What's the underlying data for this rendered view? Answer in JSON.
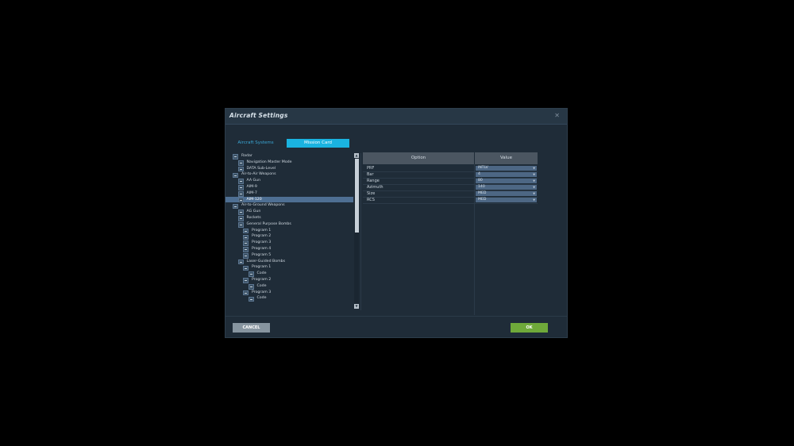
{
  "window": {
    "title": "Aircraft Settings",
    "close_glyph": "✕"
  },
  "tabs": [
    {
      "label": "Aircraft Systems",
      "active": false
    },
    {
      "label": "Mission Card",
      "active": true
    }
  ],
  "tree": [
    {
      "label": "Radar",
      "depth": 0,
      "selected": false
    },
    {
      "label": "Navigation Master Mode",
      "depth": 1,
      "selected": false
    },
    {
      "label": "DATA Sub-Level",
      "depth": 1,
      "selected": false
    },
    {
      "label": "Air-to-Air Weapons",
      "depth": 0,
      "selected": false
    },
    {
      "label": "AA Gun",
      "depth": 1,
      "selected": false
    },
    {
      "label": "AIM-9",
      "depth": 1,
      "selected": false
    },
    {
      "label": "AIM-7",
      "depth": 1,
      "selected": false
    },
    {
      "label": "AIM-120",
      "depth": 1,
      "selected": true
    },
    {
      "label": "Air-to-Ground Weapons",
      "depth": 0,
      "selected": false
    },
    {
      "label": "AG Gun",
      "depth": 1,
      "selected": false
    },
    {
      "label": "Rockets",
      "depth": 1,
      "selected": false
    },
    {
      "label": "General Purpose Bombs",
      "depth": 1,
      "selected": false
    },
    {
      "label": "Program 1",
      "depth": 2,
      "selected": false
    },
    {
      "label": "Program 2",
      "depth": 2,
      "selected": false
    },
    {
      "label": "Program 3",
      "depth": 2,
      "selected": false
    },
    {
      "label": "Program 4",
      "depth": 2,
      "selected": false
    },
    {
      "label": "Program 5",
      "depth": 2,
      "selected": false
    },
    {
      "label": "Laser-Guided Bombs",
      "depth": 1,
      "selected": false
    },
    {
      "label": "Program 1",
      "depth": 2,
      "selected": false
    },
    {
      "label": "Code",
      "depth": 3,
      "selected": false
    },
    {
      "label": "Program 2",
      "depth": 2,
      "selected": false
    },
    {
      "label": "Code",
      "depth": 3,
      "selected": false
    },
    {
      "label": "Program 3",
      "depth": 2,
      "selected": false
    },
    {
      "label": "Code",
      "depth": 3,
      "selected": false
    }
  ],
  "options_table": {
    "headers": {
      "option": "Option",
      "value": "Value"
    },
    "rows": [
      {
        "option": "PRF",
        "value": "INTLV"
      },
      {
        "option": "Bar",
        "value": "4"
      },
      {
        "option": "Range",
        "value": "80"
      },
      {
        "option": "Azimuth",
        "value": "140"
      },
      {
        "option": "Size",
        "value": "MED"
      },
      {
        "option": "RCS",
        "value": "MED"
      }
    ]
  },
  "buttons": {
    "cancel": "CANCEL",
    "ok": "OK"
  },
  "colors": {
    "accent": "#1ab3e0",
    "ok_button": "#6fa93a",
    "cancel_button": "#8795a0",
    "selected_row": "#4e6f93"
  }
}
